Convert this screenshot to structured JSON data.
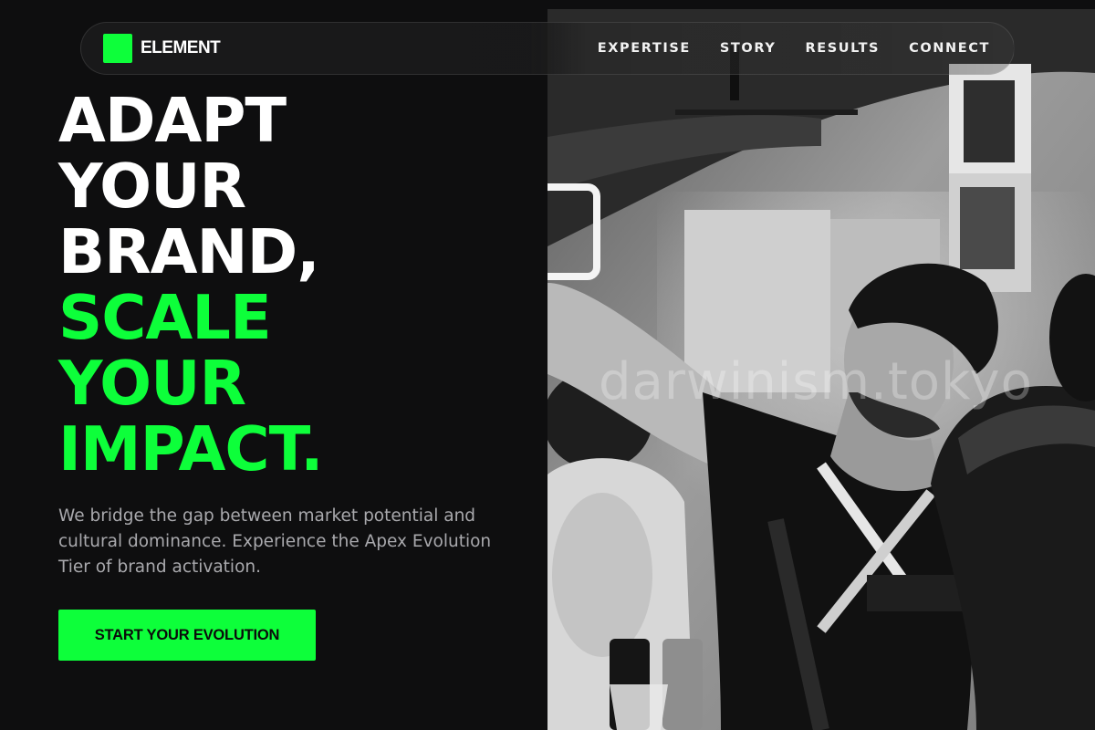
{
  "nav": {
    "brand": "ELEMENT",
    "links": [
      {
        "label": "EXPERTISE"
      },
      {
        "label": "STORY"
      },
      {
        "label": "RESULTS"
      },
      {
        "label": "CONNECT"
      }
    ]
  },
  "hero": {
    "lines": [
      "ADAPT",
      "YOUR",
      "BRAND,",
      "SCALE",
      "YOUR",
      "IMPACT."
    ],
    "description": "We bridge the gap between market potential and cultural dominance. Experience the Apex Evolution Tier of brand activation.",
    "cta_label": "START YOUR EVOLUTION"
  },
  "image": {
    "watermark": "darwinism.tokyo"
  },
  "colors": {
    "accent": "#0dff3a",
    "background": "#0e0e0f",
    "text": "#ffffff",
    "muted_text": "#a9a9ad"
  }
}
